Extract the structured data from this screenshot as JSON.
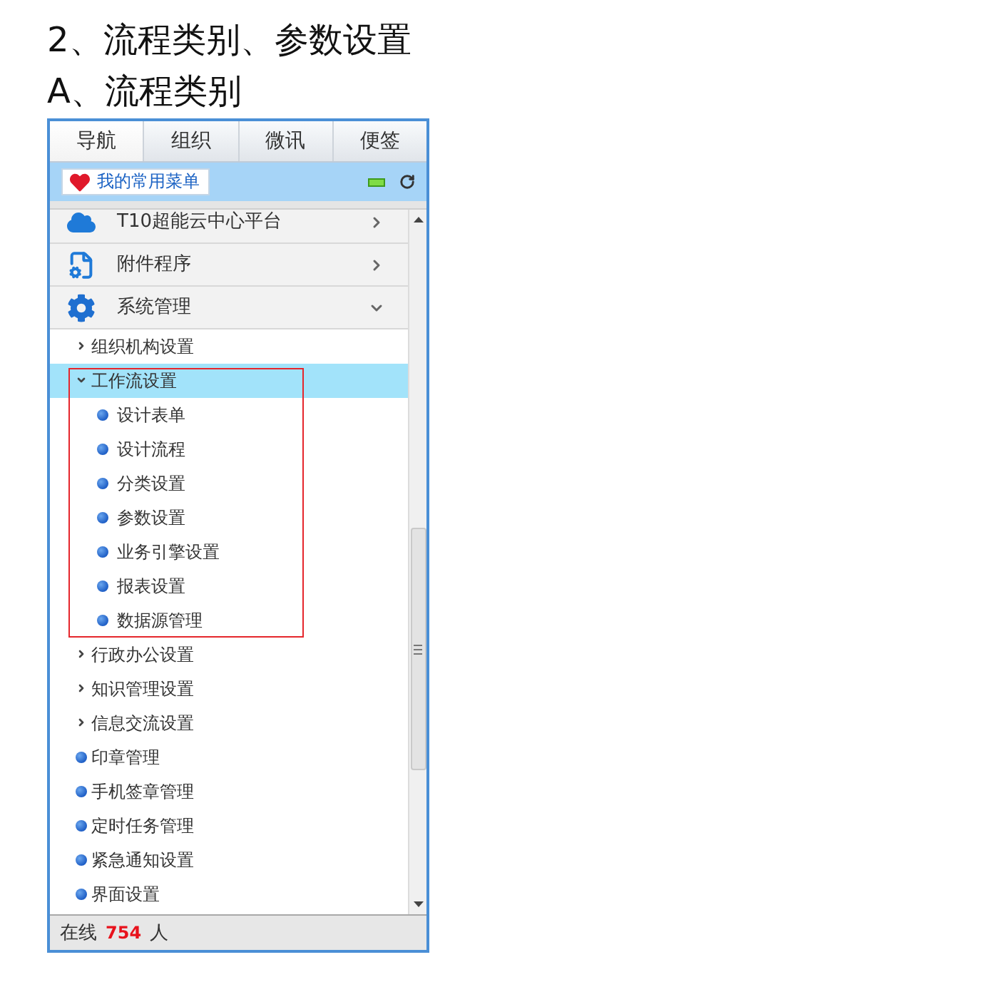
{
  "headings": [
    "2、流程类别、参数设置",
    "A、流程类别"
  ],
  "tabs": [
    {
      "label": "导航",
      "selected": true
    },
    {
      "label": "组织",
      "selected": false
    },
    {
      "label": "微讯",
      "selected": false
    },
    {
      "label": "便签",
      "selected": false
    }
  ],
  "favorites": {
    "label": "我的常用菜单"
  },
  "modules": [
    {
      "label": "T10超能云中心平台",
      "expanded": false
    },
    {
      "label": "附件程序",
      "expanded": false
    },
    {
      "label": "系统管理",
      "expanded": true
    }
  ],
  "tree": [
    {
      "label": "组织机构设置",
      "kind": "folder",
      "expanded": false,
      "selected": false,
      "outlined": false
    },
    {
      "label": "工作流设置",
      "kind": "folder",
      "expanded": true,
      "selected": true,
      "outlined": true,
      "children": [
        {
          "label": "设计表单",
          "kind": "leaf",
          "selected": false
        },
        {
          "label": "设计流程",
          "kind": "leaf",
          "selected": false
        },
        {
          "label": "分类设置",
          "kind": "leaf",
          "selected": false
        },
        {
          "label": "参数设置",
          "kind": "leaf",
          "selected": false
        },
        {
          "label": "业务引擎设置",
          "kind": "leaf",
          "selected": false
        },
        {
          "label": "报表设置",
          "kind": "leaf",
          "selected": false
        },
        {
          "label": "数据源管理",
          "kind": "leaf",
          "selected": false
        }
      ]
    },
    {
      "label": "行政办公设置",
      "kind": "folder",
      "expanded": false,
      "selected": false,
      "outlined": false
    },
    {
      "label": "知识管理设置",
      "kind": "folder",
      "expanded": false,
      "selected": false,
      "outlined": false
    },
    {
      "label": "信息交流设置",
      "kind": "folder",
      "expanded": false,
      "selected": false,
      "outlined": false
    },
    {
      "label": "印章管理",
      "kind": "leaf",
      "selected": false,
      "outlined": false
    },
    {
      "label": "手机签章管理",
      "kind": "leaf",
      "selected": false,
      "outlined": false
    },
    {
      "label": "定时任务管理",
      "kind": "leaf",
      "selected": false,
      "outlined": false
    },
    {
      "label": "紧急通知设置",
      "kind": "leaf",
      "selected": false,
      "outlined": false
    },
    {
      "label": "界面设置",
      "kind": "leaf",
      "selected": false,
      "outlined": false
    }
  ],
  "status_bar": {
    "label": "在线",
    "count": "754",
    "unit": "人"
  }
}
